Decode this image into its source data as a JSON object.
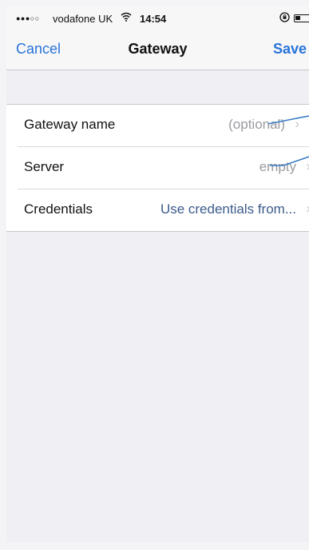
{
  "status_bar": {
    "signal": "●●●○○",
    "carrier": "vodafone UK",
    "wifi_icon": "wifi-icon",
    "time": "14:54",
    "lock_icon": "rotation-lock-icon",
    "battery_icon": "battery-icon",
    "battery_level": 0.35
  },
  "nav": {
    "cancel_label": "Cancel",
    "title": "Gateway",
    "save_label": "Save"
  },
  "rows": [
    {
      "label": "Gateway name",
      "value": "(optional)",
      "value_style": "placeholder"
    },
    {
      "label": "Server",
      "value": "empty",
      "value_style": "placeholder"
    },
    {
      "label": "Credentials",
      "value": "Use credentials from...",
      "value_style": "link"
    }
  ],
  "chevron": "›",
  "colors": {
    "accent": "#2874d8",
    "annotation": "#3b7ec6",
    "background": "#efeff4"
  }
}
